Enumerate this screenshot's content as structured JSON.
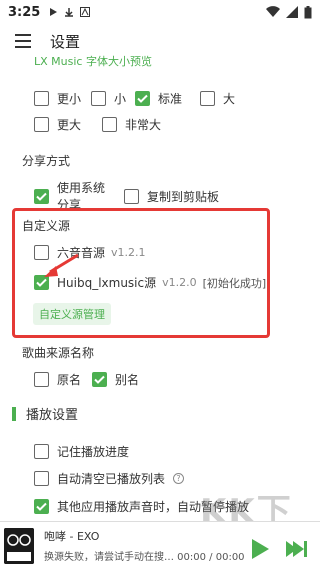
{
  "status_bar": {
    "time": "3:25"
  },
  "app_bar": {
    "title": "设置"
  },
  "font_preview": "LX Music 字体大小预览",
  "font_sizes": {
    "row1": [
      {
        "label": "更小",
        "checked": false
      },
      {
        "label": "小",
        "checked": false
      },
      {
        "label": "标准",
        "checked": true
      },
      {
        "label": "大",
        "checked": false
      }
    ],
    "row2": [
      {
        "label": "更大",
        "checked": false
      },
      {
        "label": "非常大",
        "checked": false
      }
    ]
  },
  "share": {
    "title": "分享方式",
    "system_share": {
      "label": "使用系统分享",
      "checked": true
    },
    "copy_clipboard": {
      "label": "复制到剪贴板",
      "checked": false
    }
  },
  "custom_source": {
    "title": "自定义源",
    "source1": {
      "label": "六音音源",
      "version": "v1.2.1",
      "checked": false
    },
    "source2": {
      "label": "Huibq_lxmusic源",
      "version": "v1.2.0",
      "status": "[初始化成功]",
      "checked": true
    },
    "manage_button": "自定义源管理"
  },
  "source_name": {
    "title": "歌曲来源名称",
    "original": {
      "label": "原名",
      "checked": false
    },
    "alias": {
      "label": "别名",
      "checked": true
    }
  },
  "playback": {
    "title": "播放设置",
    "remember_progress": {
      "label": "记住播放进度",
      "checked": false
    },
    "auto_clear": {
      "label": "自动清空已播放列表",
      "checked": false
    },
    "auto_pause": {
      "label": "其他应用播放声音时，自动暂停播放",
      "checked": true
    }
  },
  "player": {
    "song": "咆哮 - EXO",
    "message": "换源失败，请尝试手动在搜… 00:00 / 00:00",
    "cover_text": "EXO"
  },
  "watermark": {
    "logo": "KK下载",
    "url": "www.kkx.net"
  },
  "colors": {
    "accent": "#4caf50",
    "highlight": "#e53935"
  }
}
